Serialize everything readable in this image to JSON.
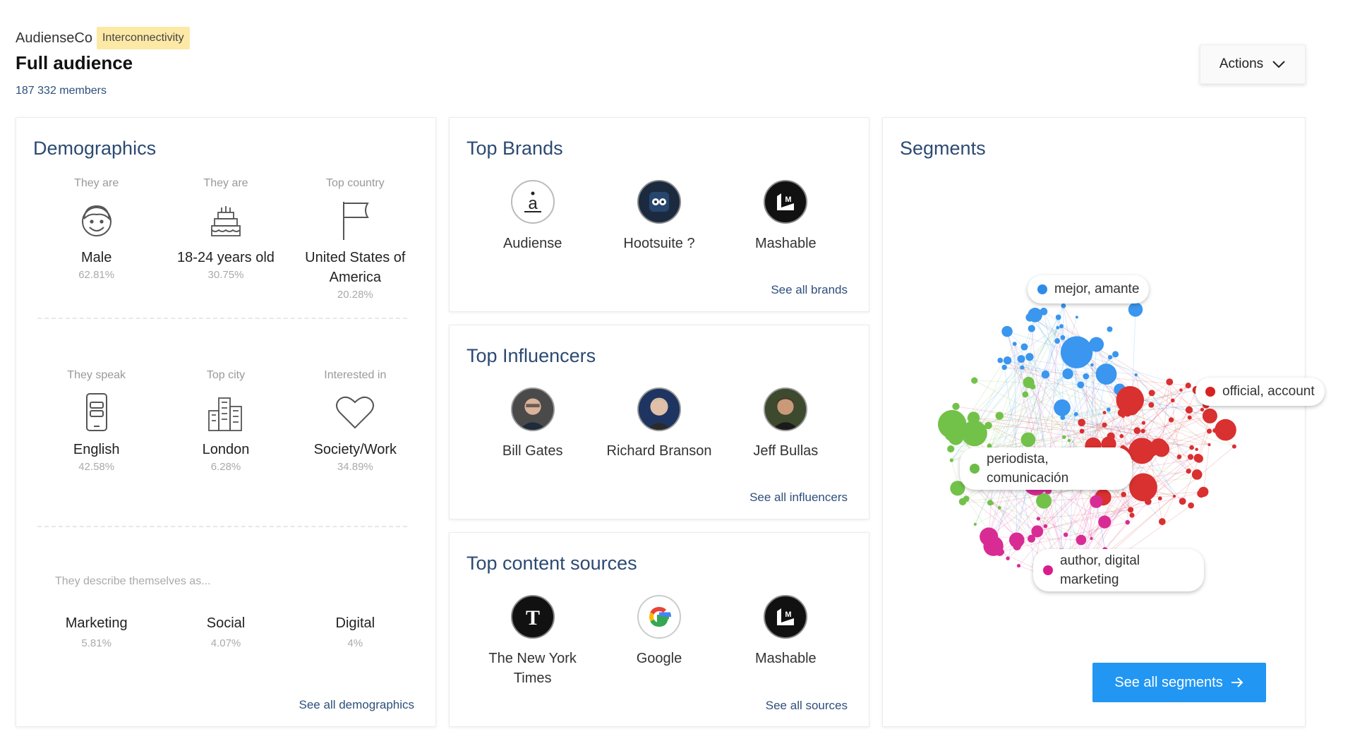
{
  "header": {
    "org": "AudienseCo",
    "badge": "Interconnectivity",
    "title": "Full audience",
    "members": "187 332 members",
    "actions_label": "Actions"
  },
  "demographics": {
    "title": "Demographics",
    "row1": [
      {
        "label": "They are",
        "icon": "male-face-icon",
        "value": "Male",
        "pct": "62.81%"
      },
      {
        "label": "They are",
        "icon": "birthday-cake-icon",
        "value": "18-24 years old",
        "pct": "30.75%"
      },
      {
        "label": "Top country",
        "icon": "flag-icon",
        "value": "United States of America",
        "pct": "20.28%"
      }
    ],
    "row2": [
      {
        "label": "They speak",
        "icon": "phone-chat-icon",
        "value": "English",
        "pct": "42.58%"
      },
      {
        "label": "Top city",
        "icon": "city-buildings-icon",
        "value": "London",
        "pct": "6.28%"
      },
      {
        "label": "Interested in",
        "icon": "heart-icon",
        "value": "Society/Work",
        "pct": "34.89%"
      }
    ],
    "describe_label": "They describe themselves as...",
    "row3": [
      {
        "value": "Marketing",
        "pct": "5.81%"
      },
      {
        "value": "Social",
        "pct": "4.07%"
      },
      {
        "value": "Digital",
        "pct": "4%"
      }
    ],
    "see_all": "See all demographics"
  },
  "brands": {
    "title": "Top Brands",
    "items": [
      {
        "name": "Audiense",
        "icon": "audiense-logo-icon"
      },
      {
        "name": "Hootsuite ?",
        "icon": "hootsuite-owl-icon"
      },
      {
        "name": "Mashable",
        "icon": "mashable-logo-icon"
      }
    ],
    "see_all": "See all brands"
  },
  "influencers": {
    "title": "Top Influencers",
    "items": [
      {
        "name": "Bill Gates",
        "icon": "avatar-icon"
      },
      {
        "name": "Richard Branson",
        "icon": "avatar-icon"
      },
      {
        "name": "Jeff Bullas",
        "icon": "avatar-icon"
      }
    ],
    "see_all": "See all influencers"
  },
  "sources": {
    "title": "Top content sources",
    "items": [
      {
        "name": "The New York Times",
        "icon": "nyt-logo-icon"
      },
      {
        "name": "Google",
        "icon": "google-logo-icon"
      },
      {
        "name": "Mashable",
        "icon": "mashable-logo-icon"
      }
    ],
    "see_all": "See all sources"
  },
  "segments": {
    "title": "Segments",
    "labels": [
      {
        "text": "mejor, amante",
        "color": "#2e8ce8"
      },
      {
        "text": "official, account",
        "color": "#d62222"
      },
      {
        "text": "periodista, comunicación",
        "color": "#6cbd45"
      },
      {
        "text": "author, digital marketing",
        "color": "#d81e8c"
      }
    ],
    "button": "See all segments"
  }
}
